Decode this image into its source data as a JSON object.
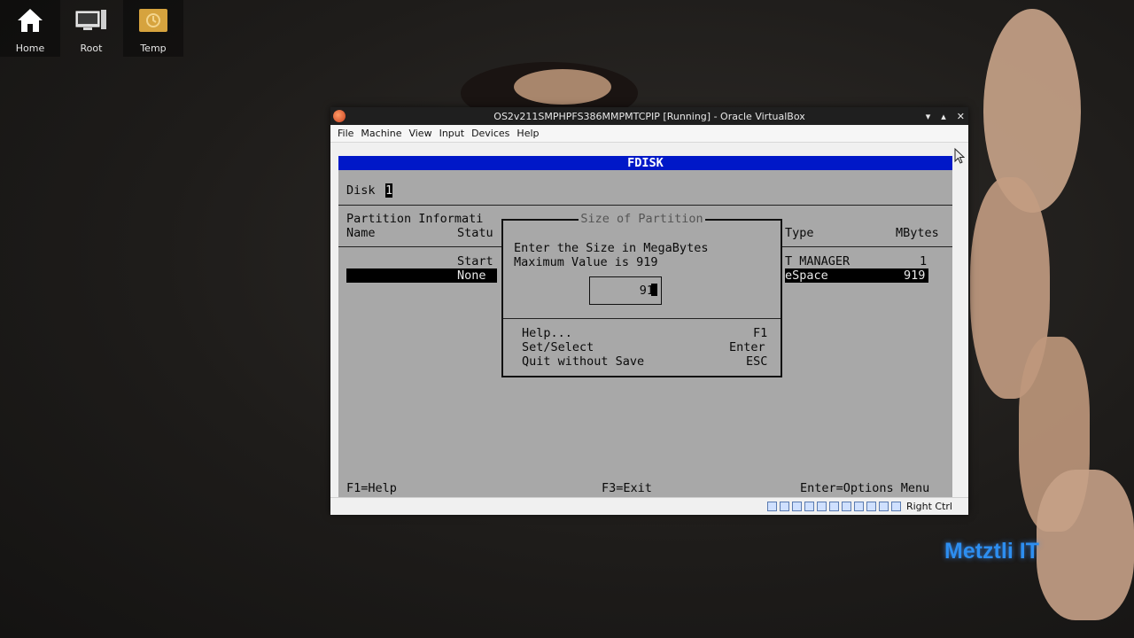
{
  "desktop": {
    "icons": [
      {
        "label": "Home",
        "icon": "home-icon"
      },
      {
        "label": "Root",
        "icon": "computer-icon"
      },
      {
        "label": "Temp",
        "icon": "folder-icon"
      }
    ],
    "watermark": "Metztli IT"
  },
  "window": {
    "title": "OS2v211SMPHPFS386MMPMTCPIP [Running] - Oracle VirtualBox",
    "menu": [
      "File",
      "Machine",
      "View",
      "Input",
      "Devices",
      "Help"
    ],
    "status_host_key": "Right Ctrl"
  },
  "guest": {
    "header": "FDISK",
    "disk_label": "Disk",
    "disk_number": "1",
    "partition_info_label": "Partition Informati",
    "col_name": "Name",
    "col_status": "Statu",
    "col_type": "Type",
    "col_mbytes": "MBytes",
    "rows": [
      {
        "status": "Start",
        "type": "T MANAGER",
        "mbytes": "1"
      },
      {
        "status": "None",
        "type": "eSpace",
        "mbytes": "919"
      }
    ],
    "footer_help": "F1=Help",
    "footer_exit": "F3=Exit",
    "footer_options": "Enter=Options Menu"
  },
  "dialog": {
    "title": "Size of Partition",
    "line1": "Enter the Size in MegaBytes",
    "line2": "Maximum Value is 919",
    "input_value": "91",
    "cursor_char": "9",
    "options": [
      {
        "label": "Help...",
        "key": "F1"
      },
      {
        "label": "Set/Select",
        "key": "Enter"
      },
      {
        "label": "Quit without Save",
        "key": "ESC"
      }
    ]
  },
  "colors": {
    "fdisk_header": "#0018c8",
    "guest_background": "#a8a8a8",
    "watermark": "#2d8ef0"
  }
}
